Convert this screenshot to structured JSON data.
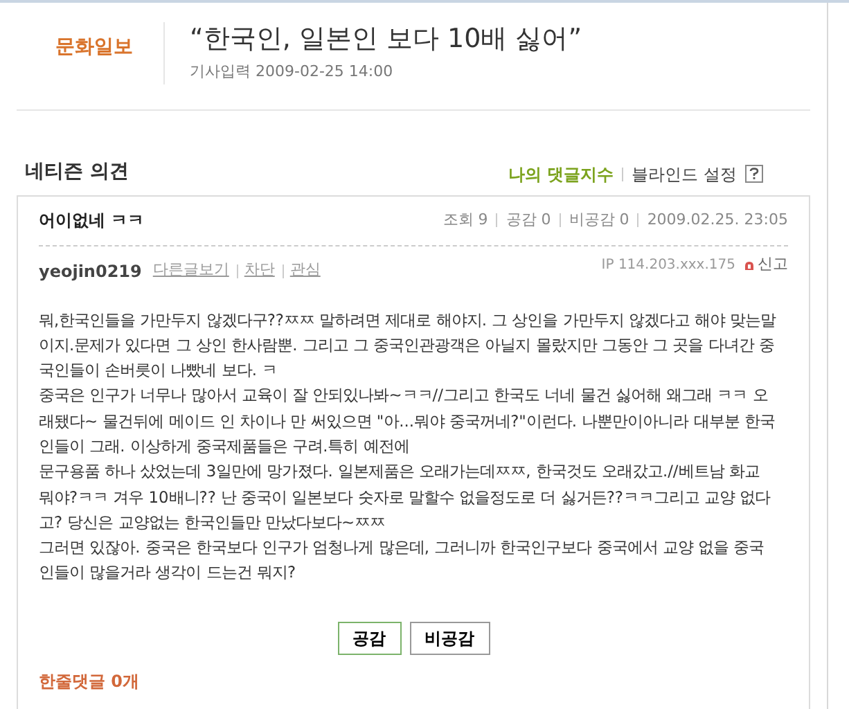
{
  "article": {
    "source": "문화일보",
    "title": "“한국인, 일본인 보다 10배 싫어”",
    "date": "기사입력 2009-02-25 14:00"
  },
  "comments_section": {
    "heading": "네티즌 의견",
    "links": [
      "나의 댓글지수",
      "블라인드 설정"
    ]
  },
  "comment": {
    "title": "어이없네 ㅋㅋ",
    "stats": [
      "조회 9",
      "공감 0",
      "비공감 0",
      "2009.02.25. 23:05"
    ],
    "author": "yeojin0219",
    "author_links": [
      "다른글보기",
      "차단",
      "관심"
    ],
    "ip": "IP 114.203.xxx.175",
    "report": "신고",
    "paragraphs": [
      "뭐,한국인들을 가만두지 않겠다구??ㅉㅉ 말하려면 제대로 해야지. 그 상인을 가만두지 않겠다고 해야 맞는말 이지.문제가 있다면 그 상인 한사람뿐. 그리고 그 중국인관광객은 아닐지 몰랐지만 그동안 그 곳을 다녀간 중국인들이 손버릇이 나빴네 보다. ㅋ",
      "중국은 인구가 너무나 많아서 교육이 잘 안되있나봐~ㅋㅋ//그리고 한국도 너네 물건 싫어해 왜그래 ㅋㅋ 오래됐다~ 물건뒤에 메이드 인 차이나 만 써있으면 \"아...뭐야 중국꺼네?\"이런다. 나뿐만이아니라 대부분 한국인들이 그래. 이상하게 중국제품들은 구려.특히 예전에",
      "문구용품 하나 샀었는데 3일만에 망가졌다. 일본제품은 오래가는데ㅉㅉ, 한국것도 오래갔고.//베트남 화교 뭐야?ㅋㅋ 겨우 10배니?? 난 중국이 일본보다 숫자로 말할수 없을정도로 더 싫거든??ㅋㅋ그리고 교양 없다고? 당신은 교양없는 한국인들만 만났다보다~ㅉㅉ",
      "그러면 있잖아. 중국은 한국보다 인구가 엄청나게 많은데, 그러니까 한국인구보다 중국에서 교양 없을 중국인들이 많을거라 생각이 드는건 뭐지?"
    ],
    "buttons": [
      "공감",
      "비공감"
    ]
  },
  "one_line_comments": "한줄댓글 0개"
}
